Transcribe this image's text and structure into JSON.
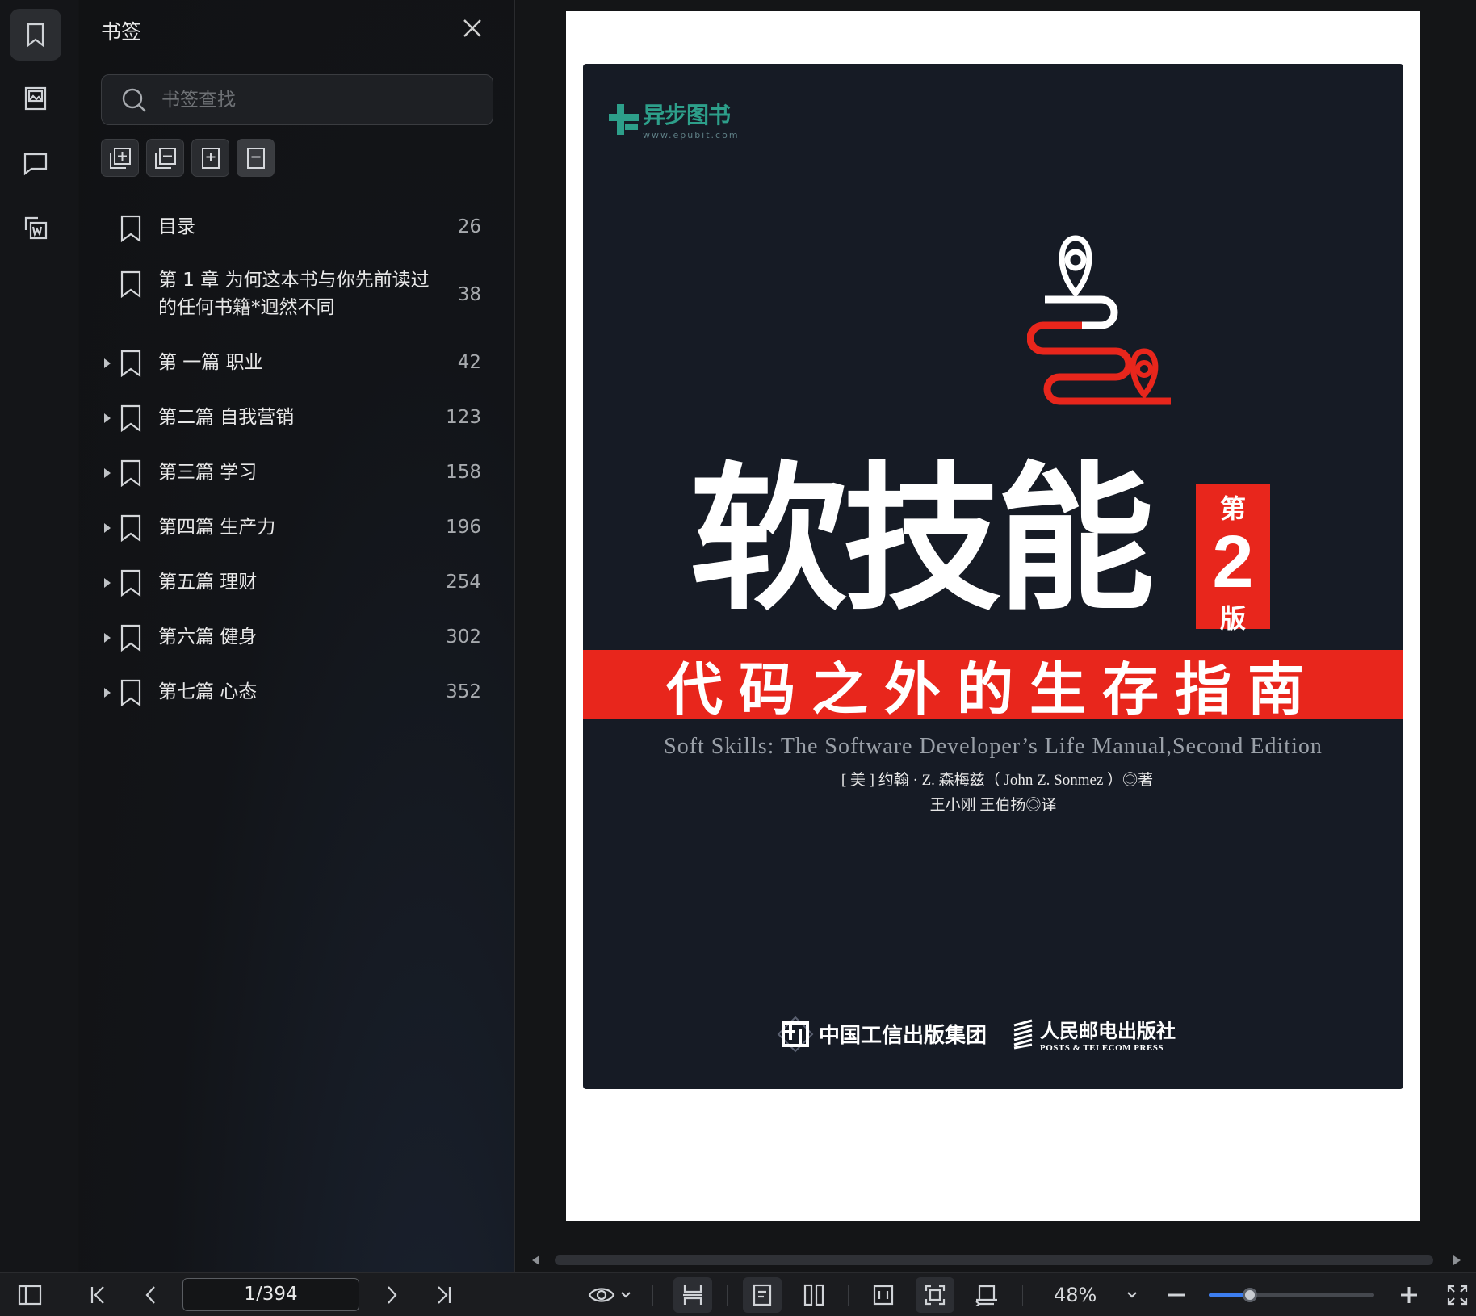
{
  "panel": {
    "title": "书签",
    "search_placeholder": "书签查找"
  },
  "bookmarks": [
    {
      "label": "目录",
      "page": "26",
      "expandable": false
    },
    {
      "label": "第 1 章 为何这本书与你先前读过的任何书籍*迥然不同",
      "page": "38",
      "expandable": false
    },
    {
      "label": "第 一篇 职业",
      "page": "42",
      "expandable": true
    },
    {
      "label": "第二篇 自我营销",
      "page": "123",
      "expandable": true
    },
    {
      "label": "第三篇 学习",
      "page": "158",
      "expandable": true
    },
    {
      "label": "第四篇 生产力",
      "page": "196",
      "expandable": true
    },
    {
      "label": "第五篇 理财",
      "page": "254",
      "expandable": true
    },
    {
      "label": "第六篇 健身",
      "page": "302",
      "expandable": true
    },
    {
      "label": "第七篇 心态",
      "page": "352",
      "expandable": true
    }
  ],
  "cover": {
    "publisher_logo_cn": "异步图书",
    "publisher_logo_url": "www.epubit.com",
    "title": "软技能",
    "edition_top": "第",
    "edition_number": "2",
    "edition_bottom": "版",
    "subtitle": "代码之外的生存指南",
    "english_title": "Soft Skills: The Software Developer’s Life Manual,Second Edition",
    "author": "[ 美 ] 约翰 · Z. 森梅兹（ John Z. Sonmez ）◎著",
    "translator": "王小刚    王伯扬◎译",
    "publisher1": "中国工信出版集团",
    "publisher2_cn": "人民邮电出版社",
    "publisher2_en": "POSTS & TELECOM PRESS"
  },
  "toolbar": {
    "page_indicator": "1/394",
    "zoom": "48%",
    "zoom_slider_fraction": 0.25
  },
  "colors": {
    "accent_red": "#e8261c",
    "cover_bg": "#161b25",
    "slider_blue": "#3d7ef0"
  }
}
